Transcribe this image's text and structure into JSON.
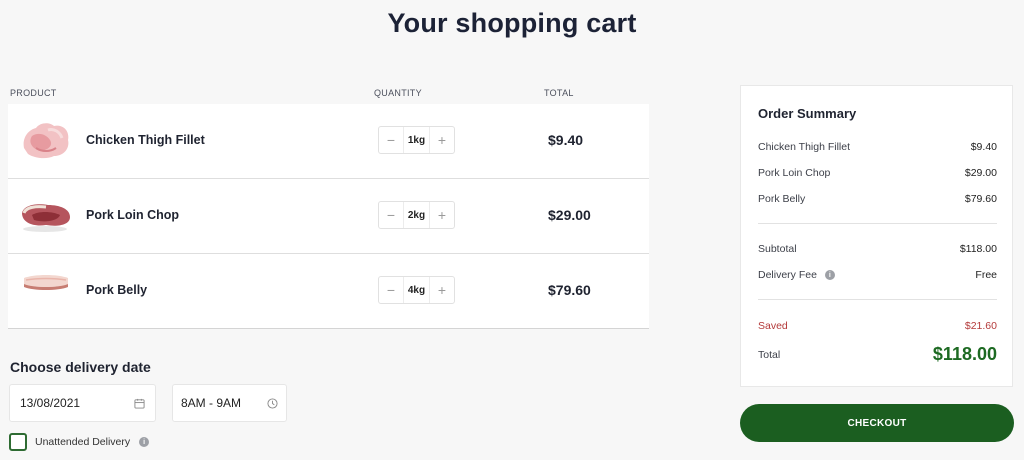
{
  "page": {
    "title": "Your shopping cart"
  },
  "columns": {
    "product": "PRODUCT",
    "quantity": "QUANTITY",
    "total": "TOTAL"
  },
  "cart": {
    "items": [
      {
        "name": "Chicken Thigh Fillet",
        "quantity": "1kg",
        "total": "$9.40",
        "decrement": "−",
        "increment": "+"
      },
      {
        "name": "Pork Loin Chop",
        "quantity": "2kg",
        "total": "$29.00",
        "decrement": "−",
        "increment": "+"
      },
      {
        "name": "Pork Belly",
        "quantity": "4kg",
        "total": "$79.60",
        "decrement": "−",
        "increment": "+"
      }
    ]
  },
  "delivery": {
    "title": "Choose delivery date",
    "date_value": "13/08/2021",
    "time_value": "8AM - 9AM",
    "unattended_label": "Unattended Delivery",
    "unattended_checked": false
  },
  "summary": {
    "title": "Order Summary",
    "lines": [
      {
        "label": "Chicken Thigh Fillet",
        "amount": "$9.40"
      },
      {
        "label": "Pork Loin Chop",
        "amount": "$29.00"
      },
      {
        "label": "Pork Belly",
        "amount": "$79.60"
      }
    ],
    "subtotal_label": "Subtotal",
    "subtotal_amount": "$118.00",
    "delivery_fee_label": "Delivery Fee",
    "delivery_fee_amount": "Free",
    "saved_label": "Saved",
    "saved_amount": "$21.60",
    "total_label": "Total",
    "total_amount": "$118.00"
  },
  "checkout": {
    "label": "CHECKOUT"
  },
  "icons": {
    "calendar": "calendar-icon",
    "clock": "clock-icon",
    "info": "info-icon"
  },
  "colors": {
    "accent": "#1b5e20",
    "total_green": "#1d6a22",
    "saved_red": "#b43a3a",
    "checkbox_border": "#2e6b32"
  }
}
